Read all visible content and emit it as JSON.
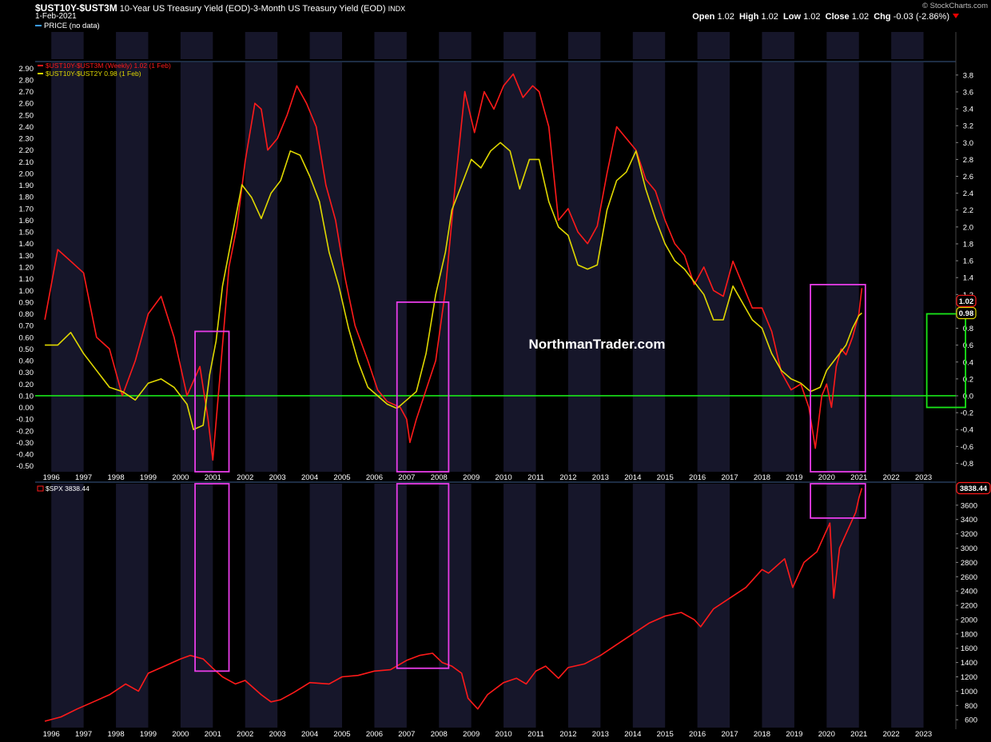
{
  "header": {
    "symbol": "$UST10Y-$UST3M",
    "description": "10-Year US Treasury Yield (EOD)-3-Month US Treasury Yield (EOD)",
    "exchange": "INDX",
    "date": "1-Feb-2021",
    "price_legend": "PRICE (no data)",
    "watermark": "© StockCharts.com",
    "ohlc": {
      "open_label": "Open",
      "open": "1.02",
      "high_label": "High",
      "high": "1.02",
      "low_label": "Low",
      "low": "1.02",
      "close_label": "Close",
      "close": "1.02",
      "chg_label": "Chg",
      "chg": "-0.03 (-2.86%)"
    }
  },
  "brand": "NorthmanTrader.com",
  "colors": {
    "red": "#ff1a1a",
    "yellow": "#e0d800",
    "green": "#19e619",
    "magenta": "#e83ce8",
    "band": "#16162a",
    "bg": "#000000"
  },
  "chart_data": [
    {
      "type": "line",
      "title": "Yield curve spreads",
      "series": [
        {
          "name": "$UST10Y-$UST3M (Weekly) 1.02 (1 Feb)",
          "axis": "left",
          "color": "#ff1a1a",
          "x": [
            1995.8,
            1996.2,
            1996.6,
            1997.0,
            1997.4,
            1997.8,
            1998.2,
            1998.6,
            1999.0,
            1999.4,
            1999.8,
            2000.2,
            2000.6,
            2000.85,
            2001.0,
            2001.2,
            2001.5,
            2001.75,
            2002.0,
            2002.3,
            2002.5,
            2002.7,
            2003.0,
            2003.3,
            2003.6,
            2003.9,
            2004.2,
            2004.5,
            2004.8,
            2005.1,
            2005.4,
            2005.8,
            2006.1,
            2006.4,
            2006.8,
            2007.0,
            2007.1,
            2007.3,
            2007.6,
            2007.9,
            2008.2,
            2008.5,
            2008.8,
            2009.1,
            2009.4,
            2009.7,
            2010.0,
            2010.3,
            2010.6,
            2010.9,
            2011.1,
            2011.4,
            2011.7,
            2012.0,
            2012.3,
            2012.6,
            2012.9,
            2013.2,
            2013.5,
            2013.8,
            2014.1,
            2014.4,
            2014.7,
            2015.0,
            2015.3,
            2015.6,
            2015.9,
            2016.2,
            2016.5,
            2016.8,
            2017.1,
            2017.4,
            2017.7,
            2018.0,
            2018.3,
            2018.6,
            2018.9,
            2019.2,
            2019.45,
            2019.65,
            2019.85,
            2020.0,
            2020.15,
            2020.3,
            2020.45,
            2020.6,
            2020.8,
            2021.0,
            2021.09
          ],
          "y": [
            0.75,
            1.35,
            1.25,
            1.15,
            0.6,
            0.5,
            0.1,
            0.4,
            0.8,
            0.95,
            0.6,
            0.1,
            0.35,
            -0.1,
            -0.45,
            0.2,
            1.2,
            1.55,
            2.1,
            2.6,
            2.55,
            2.2,
            2.3,
            2.5,
            2.75,
            2.6,
            2.4,
            1.9,
            1.6,
            1.1,
            0.7,
            0.4,
            0.15,
            0.05,
            0.0,
            -0.1,
            -0.3,
            -0.1,
            0.15,
            0.4,
            1.0,
            1.9,
            2.7,
            2.35,
            2.7,
            2.55,
            2.75,
            2.85,
            2.65,
            2.75,
            2.7,
            2.4,
            1.6,
            1.7,
            1.5,
            1.4,
            1.55,
            2.0,
            2.4,
            2.3,
            2.2,
            1.95,
            1.85,
            1.6,
            1.4,
            1.3,
            1.05,
            1.2,
            1.0,
            0.95,
            1.25,
            1.05,
            0.85,
            0.85,
            0.65,
            0.3,
            0.15,
            0.2,
            0.0,
            -0.35,
            0.1,
            0.2,
            0.0,
            0.35,
            0.5,
            0.45,
            0.6,
            0.8,
            1.02
          ]
        },
        {
          "name": "$UST10Y-$UST2Y 0.98 (1 Feb)",
          "axis": "right",
          "color": "#e0d800",
          "x": [
            1995.8,
            1996.2,
            1996.6,
            1997.0,
            1997.4,
            1997.8,
            1998.2,
            1998.6,
            1999.0,
            1999.4,
            1999.8,
            2000.2,
            2000.4,
            2000.7,
            2000.9,
            2001.1,
            2001.3,
            2001.6,
            2001.9,
            2002.2,
            2002.5,
            2002.8,
            2003.1,
            2003.4,
            2003.7,
            2004.0,
            2004.3,
            2004.6,
            2004.9,
            2005.2,
            2005.5,
            2005.8,
            2006.1,
            2006.4,
            2006.7,
            2007.0,
            2007.3,
            2007.6,
            2007.9,
            2008.2,
            2008.4,
            2008.7,
            2009.0,
            2009.3,
            2009.6,
            2009.9,
            2010.2,
            2010.5,
            2010.8,
            2011.1,
            2011.4,
            2011.7,
            2012.0,
            2012.3,
            2012.6,
            2012.9,
            2013.2,
            2013.5,
            2013.8,
            2014.1,
            2014.4,
            2014.7,
            2015.0,
            2015.3,
            2015.6,
            2015.9,
            2016.2,
            2016.5,
            2016.8,
            2017.1,
            2017.4,
            2017.7,
            2018.0,
            2018.3,
            2018.6,
            2018.9,
            2019.2,
            2019.5,
            2019.8,
            2020.0,
            2020.2,
            2020.4,
            2020.6,
            2020.8,
            2021.0,
            2021.09
          ],
          "y": [
            0.6,
            0.6,
            0.75,
            0.5,
            0.3,
            0.1,
            0.05,
            -0.05,
            0.15,
            0.2,
            0.1,
            -0.1,
            -0.4,
            -0.35,
            0.25,
            0.65,
            1.3,
            1.9,
            2.5,
            2.35,
            2.1,
            2.4,
            2.55,
            2.9,
            2.85,
            2.6,
            2.3,
            1.7,
            1.3,
            0.8,
            0.4,
            0.1,
            0.0,
            -0.1,
            -0.15,
            -0.05,
            0.05,
            0.5,
            1.2,
            1.7,
            2.2,
            2.5,
            2.8,
            2.7,
            2.9,
            3.0,
            2.9,
            2.45,
            2.8,
            2.8,
            2.3,
            2.0,
            1.9,
            1.55,
            1.5,
            1.55,
            2.2,
            2.55,
            2.65,
            2.9,
            2.45,
            2.1,
            1.8,
            1.6,
            1.5,
            1.35,
            1.2,
            0.9,
            0.9,
            1.3,
            1.1,
            0.9,
            0.8,
            0.5,
            0.3,
            0.2,
            0.15,
            0.05,
            0.1,
            0.3,
            0.4,
            0.5,
            0.6,
            0.8,
            0.95,
            0.98
          ]
        }
      ],
      "left_axis": {
        "ticks": [
          "2.90",
          "2.80",
          "2.70",
          "2.60",
          "2.50",
          "2.40",
          "2.30",
          "2.20",
          "2.10",
          "2.00",
          "1.90",
          "1.80",
          "1.70",
          "1.60",
          "1.50",
          "1.40",
          "1.30",
          "1.20",
          "1.10",
          "1.00",
          "0.90",
          "0.80",
          "0.70",
          "0.60",
          "0.50",
          "0.40",
          "0.30",
          "0.20",
          "0.10",
          "0.00",
          "-0.10",
          "-0.20",
          "-0.30",
          "-0.40",
          "-0.50"
        ],
        "ylim": [
          -0.55,
          2.95
        ]
      },
      "right_axis": {
        "ticks": [
          "3.8",
          "3.6",
          "3.4",
          "3.2",
          "3.0",
          "2.8",
          "2.6",
          "2.4",
          "2.2",
          "2.0",
          "1.8",
          "1.6",
          "1.4",
          "1.2",
          "1.0",
          "0.8",
          "0.6",
          "0.4",
          "0.2",
          "0.0",
          "-0.2",
          "-0.4",
          "-0.6",
          "-0.8"
        ],
        "ylim": [
          -0.9,
          3.95
        ]
      },
      "last_labels": [
        "0.98",
        "1.02"
      ],
      "reference_line": {
        "value": 0.1,
        "color": "#19e619"
      },
      "highlight_boxes": [
        {
          "x": [
            2000.45,
            2001.5
          ],
          "y": [
            -0.55,
            0.65
          ]
        },
        {
          "x": [
            2006.7,
            2008.3
          ],
          "y": [
            -0.55,
            0.9
          ]
        },
        {
          "x": [
            2019.5,
            2021.2
          ],
          "y": [
            -0.55,
            1.05
          ]
        },
        {
          "x": [
            2023.1,
            2024.3
          ],
          "y": [
            0.0,
            0.8
          ],
          "color": "#19e619"
        }
      ]
    },
    {
      "type": "line",
      "series": [
        {
          "name": "$SPX 3838.44",
          "color": "#ff1a1a",
          "x": [
            1995.8,
            1996.3,
            1996.8,
            1997.3,
            1997.8,
            1998.3,
            1998.7,
            1999.0,
            1999.5,
            2000.0,
            2000.3,
            2000.7,
            2001.0,
            2001.3,
            2001.7,
            2002.0,
            2002.5,
            2002.8,
            2003.1,
            2003.5,
            2004.0,
            2004.6,
            2005.0,
            2005.5,
            2006.0,
            2006.5,
            2007.0,
            2007.4,
            2007.8,
            2008.1,
            2008.4,
            2008.7,
            2008.9,
            2009.2,
            2009.5,
            2010.0,
            2010.4,
            2010.7,
            2011.0,
            2011.3,
            2011.7,
            2012.0,
            2012.5,
            2013.0,
            2013.5,
            2014.0,
            2014.5,
            2015.0,
            2015.5,
            2015.9,
            2016.1,
            2016.5,
            2017.0,
            2017.5,
            2018.0,
            2018.2,
            2018.7,
            2018.95,
            2019.3,
            2019.7,
            2020.0,
            2020.1,
            2020.22,
            2020.4,
            2020.7,
            2020.9,
            2021.0,
            2021.09
          ],
          "y": [
            580,
            640,
            750,
            850,
            950,
            1100,
            1000,
            1250,
            1350,
            1450,
            1500,
            1450,
            1320,
            1200,
            1100,
            1150,
            950,
            850,
            880,
            980,
            1120,
            1100,
            1200,
            1220,
            1280,
            1300,
            1430,
            1500,
            1530,
            1400,
            1350,
            1250,
            900,
            750,
            950,
            1120,
            1180,
            1100,
            1280,
            1350,
            1180,
            1330,
            1380,
            1500,
            1650,
            1800,
            1950,
            2050,
            2100,
            2000,
            1900,
            2150,
            2300,
            2450,
            2700,
            2650,
            2850,
            2450,
            2800,
            2950,
            3250,
            3350,
            2300,
            3000,
            3300,
            3500,
            3700,
            3838
          ]
        }
      ],
      "axis": {
        "ticks": [
          "3600",
          "3400",
          "3200",
          "3000",
          "2800",
          "2600",
          "2400",
          "2200",
          "2000",
          "1800",
          "1600",
          "1400",
          "1200",
          "1000",
          "800",
          "600"
        ],
        "ylim": [
          490,
          3900
        ]
      },
      "last_label": "3838.44",
      "highlight_boxes": [
        {
          "x": [
            2000.45,
            2001.5
          ],
          "y": [
            1280,
            3900
          ]
        },
        {
          "x": [
            2006.7,
            2008.3
          ],
          "y": [
            1320,
            3900
          ]
        },
        {
          "x": [
            2019.5,
            2021.2
          ],
          "y": [
            3420,
            3900
          ]
        }
      ]
    }
  ],
  "x_axis": {
    "ticks": [
      "1996",
      "1997",
      "1998",
      "1999",
      "2000",
      "2001",
      "2002",
      "2003",
      "2004",
      "2005",
      "2006",
      "2007",
      "2008",
      "2009",
      "2010",
      "2011",
      "2012",
      "2013",
      "2014",
      "2015",
      "2016",
      "2017",
      "2018",
      "2019",
      "2020",
      "2021",
      "2022",
      "2023"
    ]
  }
}
